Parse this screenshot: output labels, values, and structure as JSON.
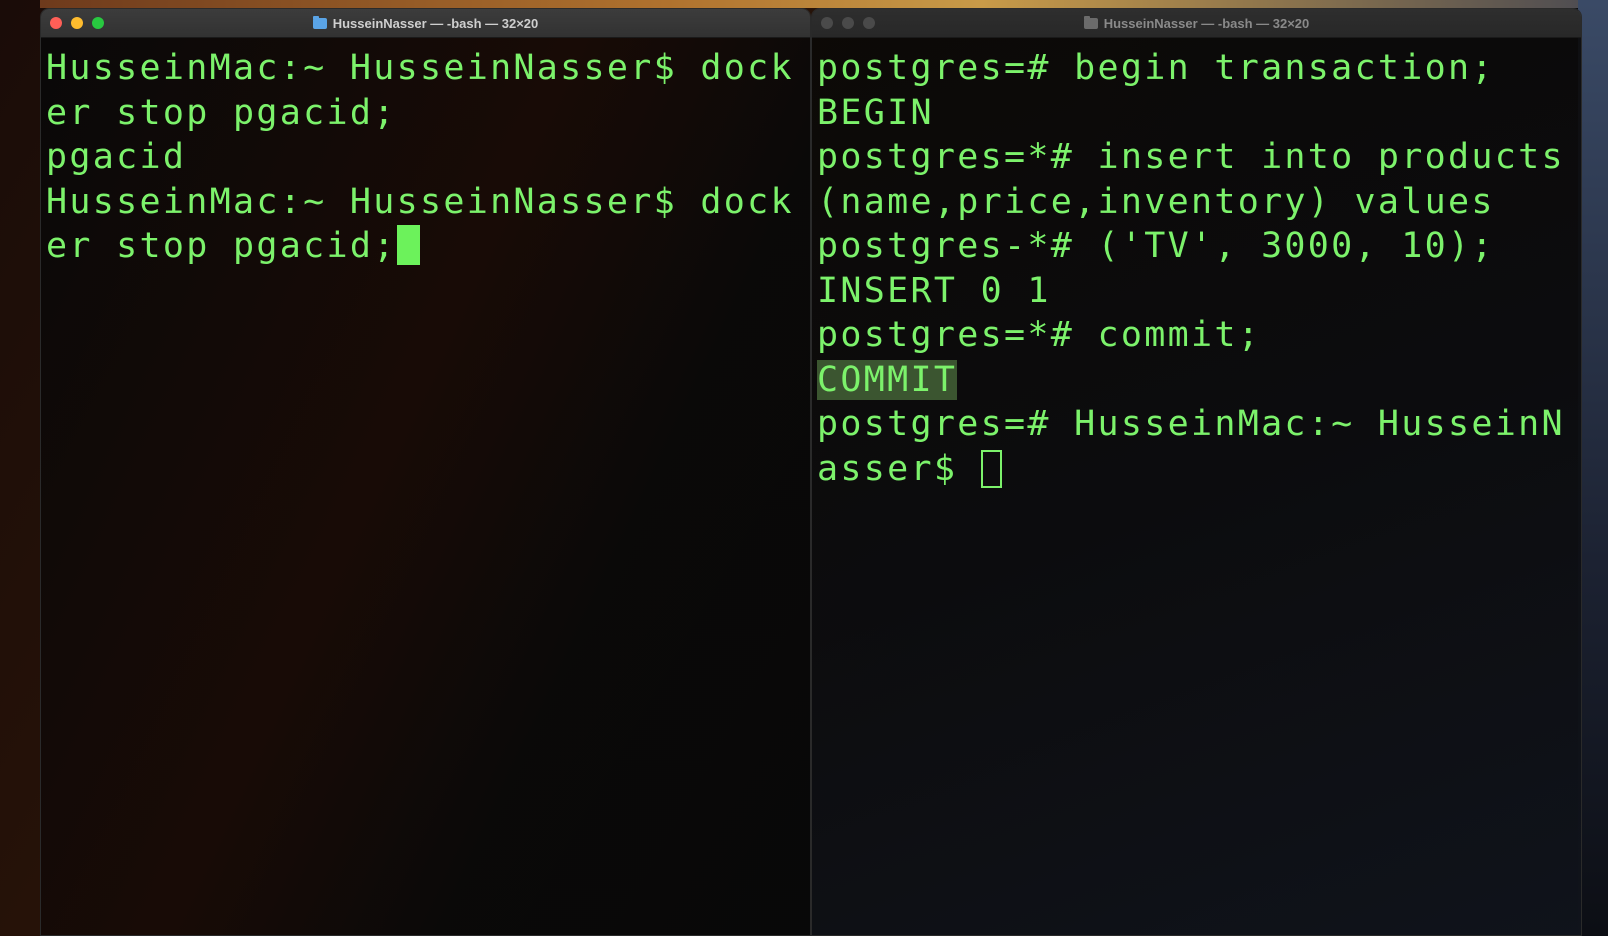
{
  "left_window": {
    "title": "HusseinNasser — -bash — 32×20",
    "lines": [
      "HusseinMac:~ HusseinNasser$ dock",
      "er stop pgacid;",
      "pgacid",
      "HusseinMac:~ HusseinNasser$ dock",
      "er stop pgacid;"
    ]
  },
  "right_window": {
    "title": "HusseinNasser — -bash — 32×20",
    "lines": [
      "postgres=# begin transaction;",
      "BEGIN",
      "postgres=*# insert into products",
      "(name,price,inventory) values",
      "postgres-*# ('TV', 3000, 10);",
      "INSERT 0 1",
      "postgres=*# commit;",
      "COMMIT",
      "postgres=# HusseinMac:~ HusseinN",
      "asser$ "
    ]
  },
  "colors": {
    "terminal_text": "#7cf26b",
    "selection_highlight": "#3b5530",
    "close_button": "#fe5f57",
    "minimize_button": "#febc2e",
    "zoom_button": "#28c840"
  },
  "icons": [
    "folder-icon"
  ]
}
